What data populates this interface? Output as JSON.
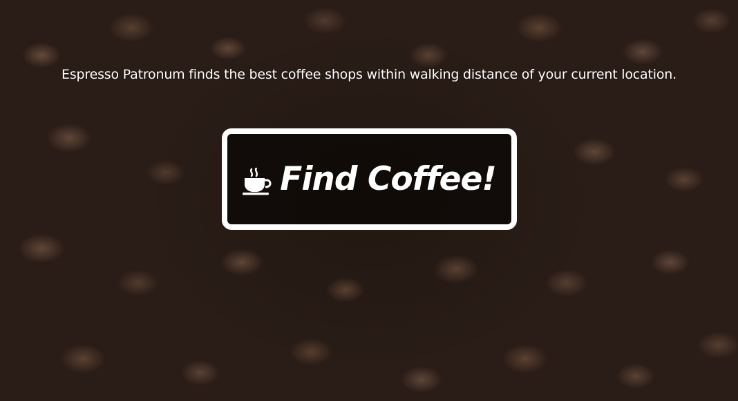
{
  "tagline": "Espresso Patronum finds the best coffee shops within walking distance of your current location.",
  "find_button": {
    "label": "Find Coffee!",
    "icon": "coffee-cup-icon"
  },
  "colors": {
    "text": "#ffffff",
    "button_border": "#ffffff",
    "background": "#2a1d17"
  }
}
